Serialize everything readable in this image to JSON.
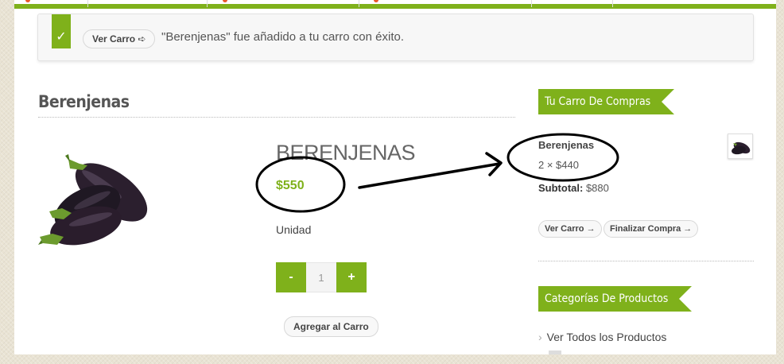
{
  "notice": {
    "button_label": "Ver Carro ➪",
    "message": "\"Berenjenas\" fue añadido a tu carro con éxito."
  },
  "product": {
    "page_title": "Berenjenas",
    "name": "BERENJENAS",
    "price": "$550",
    "unit": "Unidad",
    "qty_minus": "-",
    "qty_value": "1",
    "qty_plus": "+",
    "add_button": "Agregar al Carro"
  },
  "sidebar": {
    "cart_title": "Tu Carro De Compras",
    "item_name": "Berenjenas",
    "item_qty": "2 × $440",
    "subtotal_label": "Subtotal:",
    "subtotal_value": "$880",
    "view_cart": "Ver Carro →",
    "checkout": "Finalizar Compra →",
    "categories_title": "Categorías De Productos",
    "categories": [
      {
        "label": "Ver Todos los Productos"
      }
    ]
  },
  "colors": {
    "accent": "#7fb11b",
    "price": "#7fb11b"
  }
}
